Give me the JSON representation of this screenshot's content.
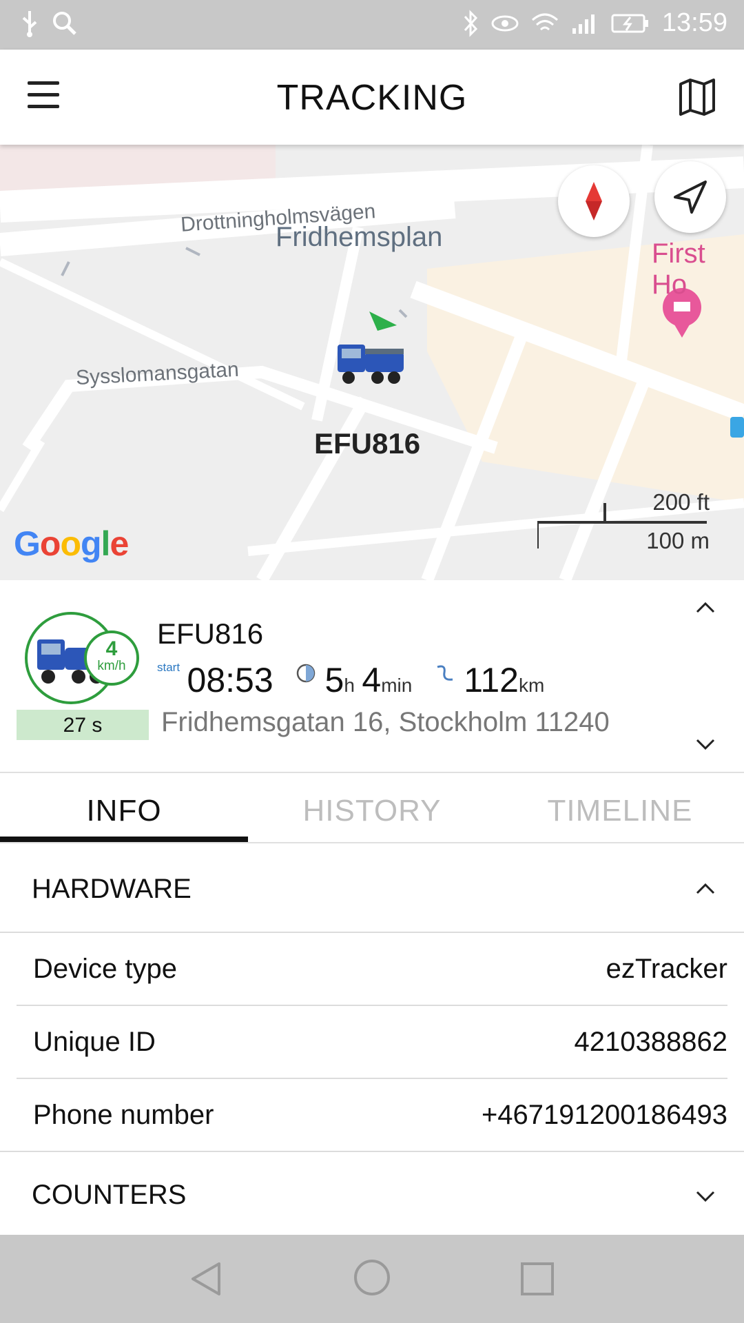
{
  "status_bar": {
    "time": "13:59"
  },
  "app_bar": {
    "title": "TRACKING"
  },
  "map": {
    "street_labels": [
      "Drottningholmsvägen",
      "Fridhemsplan",
      "Sysslomansgatan",
      "First Ho"
    ],
    "vehicle_label": "EFU816",
    "google_text": "Google",
    "scale_ft": "200 ft",
    "scale_m": "100 m"
  },
  "vehicle": {
    "name": "EFU816",
    "speed_value": "4",
    "speed_unit": "km/h",
    "last_update": "27 s",
    "start_label": "start",
    "start_time": "08:53",
    "duration_hours": "5",
    "duration_hours_unit": "h",
    "duration_minutes": "4",
    "duration_minutes_unit": "min",
    "distance": "112",
    "distance_unit": "km",
    "address": "Fridhemsgatan 16, Stockholm 11240"
  },
  "tabs": [
    {
      "label": "INFO",
      "active": true
    },
    {
      "label": "HISTORY",
      "active": false
    },
    {
      "label": "TIMELINE",
      "active": false
    }
  ],
  "sections": {
    "hardware": {
      "title": "HARDWARE",
      "rows": [
        {
          "key": "Device type",
          "value": "ezTracker"
        },
        {
          "key": "Unique ID",
          "value": "4210388862"
        },
        {
          "key": "Phone number",
          "value": "+467191200186493"
        }
      ]
    },
    "counters": {
      "title": "COUNTERS"
    }
  },
  "colors": {
    "accent_green": "#2e9d3d",
    "age_bg": "#cde9cd",
    "start_blue": "#2b78c2"
  }
}
